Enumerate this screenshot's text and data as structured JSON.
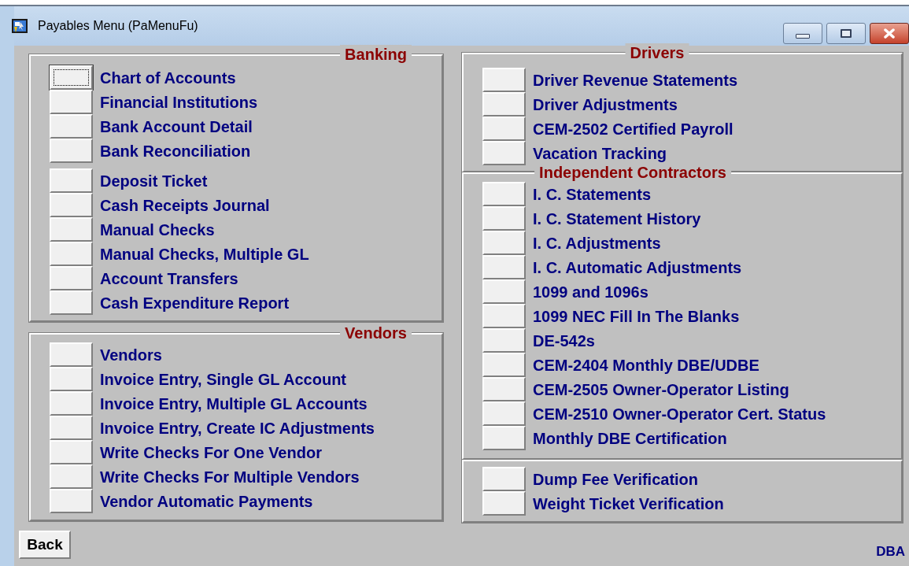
{
  "window": {
    "title": "Payables Menu (PaMenuFu)"
  },
  "columns": [
    [
      {
        "heading": "Banking",
        "sections": [
          [
            {
              "label": "Chart of Accounts",
              "focused": true
            },
            {
              "label": "Financial Institutions",
              "focused": false
            },
            {
              "label": "Bank Account Detail",
              "focused": false
            },
            {
              "label": "Bank Reconciliation",
              "focused": false
            }
          ],
          [
            {
              "label": "Deposit Ticket",
              "focused": false
            },
            {
              "label": "Cash Receipts Journal",
              "focused": false
            },
            {
              "label": "Manual Checks",
              "focused": false
            },
            {
              "label": "Manual Checks, Multiple GL",
              "focused": false
            },
            {
              "label": "Account Transfers",
              "focused": false
            },
            {
              "label": "Cash Expenditure Report",
              "focused": false
            }
          ]
        ]
      },
      {
        "heading": "Vendors",
        "sections": [
          [
            {
              "label": "Vendors",
              "focused": false
            },
            {
              "label": "Invoice Entry, Single GL Account",
              "focused": false
            },
            {
              "label": "Invoice Entry, Multiple GL Accounts",
              "focused": false
            },
            {
              "label": "Invoice Entry, Create IC Adjustments",
              "focused": false
            },
            {
              "label": "Write Checks For One Vendor",
              "focused": false
            },
            {
              "label": "Write Checks For Multiple Vendors",
              "focused": false
            },
            {
              "label": "Vendor Automatic Payments",
              "focused": false
            }
          ]
        ]
      }
    ],
    [
      {
        "heading": "Drivers",
        "sections": [
          [
            {
              "label": "Driver Revenue Statements",
              "focused": false
            },
            {
              "label": "Driver Adjustments",
              "focused": false
            },
            {
              "label": "CEM-2502 Certified Payroll",
              "focused": false
            },
            {
              "label": "Vacation Tracking",
              "focused": false
            }
          ]
        ]
      },
      {
        "heading": "Independent Contractors",
        "sections": [
          [
            {
              "label": "I. C. Statements",
              "focused": false
            },
            {
              "label": "I. C. Statement History",
              "focused": false
            },
            {
              "label": "I. C. Adjustments",
              "focused": false
            },
            {
              "label": "I. C. Automatic Adjustments",
              "focused": false
            },
            {
              "label": "1099 and 1096s",
              "focused": false
            },
            {
              "label": "1099 NEC Fill In The Blanks",
              "focused": false
            },
            {
              "label": "DE-542s",
              "focused": false
            },
            {
              "label": "CEM-2404 Monthly DBE/UDBE",
              "focused": false
            },
            {
              "label": "CEM-2505 Owner-Operator Listing",
              "focused": false
            },
            {
              "label": "CEM-2510 Owner-Operator Cert. Status",
              "focused": false
            },
            {
              "label": "Monthly DBE Certification",
              "focused": false
            }
          ]
        ]
      },
      {
        "sections": [
          [
            {
              "label": "Dump Fee Verification",
              "focused": false
            },
            {
              "label": "Weight Ticket Verification",
              "focused": false
            }
          ]
        ]
      }
    ]
  ],
  "back_button": "Back",
  "footer": "DBA"
}
